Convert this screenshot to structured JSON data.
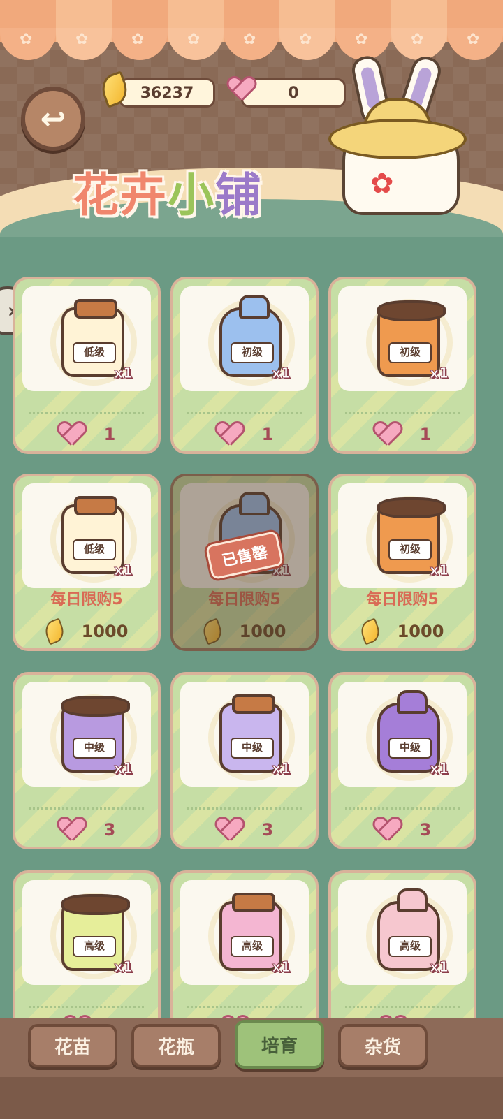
{
  "header": {
    "title_chars": [
      "花",
      "卉",
      "小",
      "铺"
    ],
    "back_icon": "back-arrow-icon",
    "gold_amount": "36237",
    "heart_amount": "0"
  },
  "side_tab": {
    "icon": "chevron-right-icon",
    "label": "»"
  },
  "cards": [
    {
      "item": "jar",
      "color": "#fff3d6",
      "label": "低级",
      "qty": "x1",
      "limit": "",
      "currency": "heart",
      "price": "1",
      "sold": false
    },
    {
      "item": "bag",
      "color": "#9cc0ee",
      "label": "初级",
      "qty": "x1",
      "limit": "",
      "currency": "heart",
      "price": "1",
      "sold": false
    },
    {
      "item": "sack",
      "color": "#ef9a4f",
      "label": "初级",
      "qty": "x1",
      "limit": "",
      "currency": "heart",
      "price": "1",
      "sold": false
    },
    {
      "item": "jar",
      "color": "#fff3d6",
      "label": "低级",
      "qty": "x1",
      "limit": "每日限购5",
      "currency": "gold",
      "price": "1000",
      "sold": false
    },
    {
      "item": "bag",
      "color": "#9cc0ee",
      "label": "初级",
      "qty": "x1",
      "limit": "每日限购5",
      "currency": "gold",
      "price": "1000",
      "sold": true,
      "sold_label": "已售罄"
    },
    {
      "item": "sack",
      "color": "#ef9a4f",
      "label": "初级",
      "qty": "x1",
      "limit": "每日限购5",
      "currency": "gold",
      "price": "1000",
      "sold": false
    },
    {
      "item": "sack",
      "color": "#b89ae0",
      "label": "中级",
      "qty": "x1",
      "limit": "",
      "currency": "heart",
      "price": "3",
      "sold": false
    },
    {
      "item": "jar",
      "color": "#c9b6ee",
      "label": "中级",
      "qty": "x1",
      "limit": "",
      "currency": "heart",
      "price": "3",
      "sold": false
    },
    {
      "item": "bag",
      "color": "#a57ed8",
      "label": "中级",
      "qty": "x1",
      "limit": "",
      "currency": "heart",
      "price": "3",
      "sold": false
    },
    {
      "item": "sack",
      "color": "#e6ee9a",
      "label": "高级",
      "qty": "x1",
      "limit": "",
      "currency": "heart",
      "price": "",
      "sold": false
    },
    {
      "item": "jar",
      "color": "#f4b6d2",
      "label": "高级",
      "qty": "x1",
      "limit": "",
      "currency": "heart",
      "price": "",
      "sold": false
    },
    {
      "item": "bag",
      "color": "#f6c7cf",
      "label": "高级",
      "qty": "x1",
      "limit": "",
      "currency": "heart",
      "price": "",
      "sold": false
    }
  ],
  "tabs": [
    {
      "label": "花苗",
      "active": false
    },
    {
      "label": "花瓶",
      "active": false
    },
    {
      "label": "培育",
      "active": true
    },
    {
      "label": "杂货",
      "active": false
    }
  ]
}
